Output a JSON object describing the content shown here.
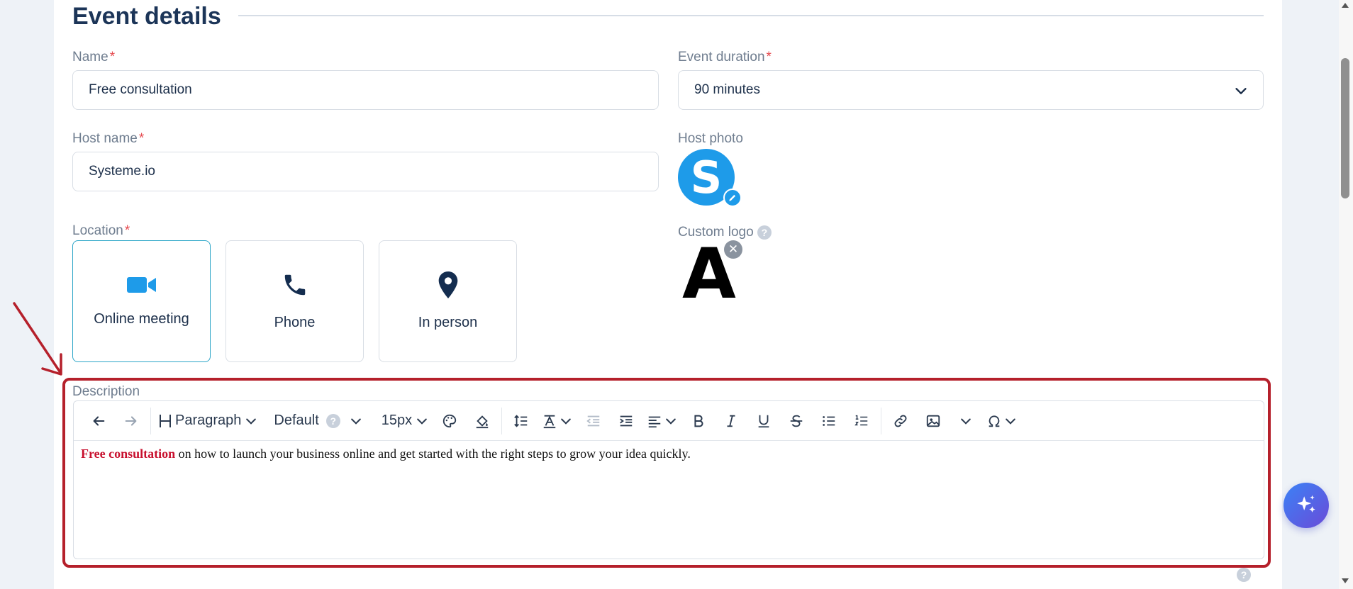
{
  "section": {
    "title": "Event details"
  },
  "fields": {
    "name": {
      "label": "Name",
      "required": "*",
      "value": "Free consultation"
    },
    "duration": {
      "label": "Event duration",
      "required": "*",
      "value": "90 minutes"
    },
    "host_name": {
      "label": "Host name",
      "required": "*",
      "value": "Systeme.io"
    },
    "host_photo": {
      "label": "Host photo",
      "initial": "S"
    },
    "custom_logo": {
      "label": "Custom logo",
      "help": "?",
      "letter": "A",
      "remove": "✕"
    },
    "location": {
      "label": "Location",
      "required": "*",
      "options": [
        {
          "label": "Online meeting",
          "icon": "video-camera-icon",
          "selected": true
        },
        {
          "label": "Phone",
          "icon": "phone-icon",
          "selected": false
        },
        {
          "label": "In person",
          "icon": "map-pin-icon",
          "selected": false
        }
      ]
    },
    "description": {
      "label": "Description",
      "toolbar": {
        "block_format": "Paragraph",
        "font_family": "Default",
        "font_help": "?",
        "font_size": "15px"
      },
      "content": {
        "highlight": "Free consultation",
        "rest": " on how to launch your business online and get started with the right steps to grow your idea quickly."
      }
    }
  },
  "colors": {
    "accent": "#1e9be9",
    "highlight_border": "#b5202b",
    "required": "#e5484d",
    "content_highlight": "#c8102e",
    "ai_button_start": "#3b82f6",
    "ai_button_end": "#6a4bd8"
  },
  "footer": {
    "help": "?"
  }
}
